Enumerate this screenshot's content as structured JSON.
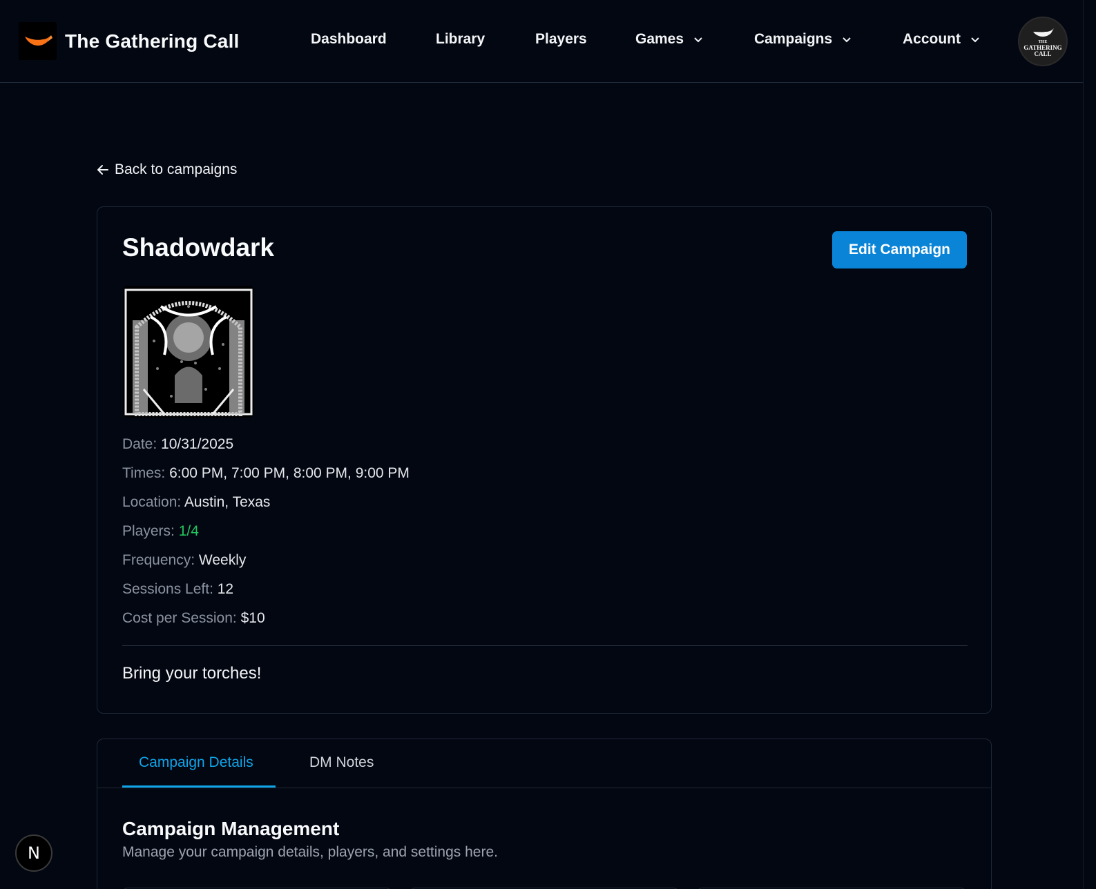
{
  "app": {
    "name": "The Gathering Call",
    "avatar_text_small": "THE",
    "avatar_text_main": "GATHERING",
    "avatar_text_end": "CALL"
  },
  "nav": {
    "dashboard": "Dashboard",
    "library": "Library",
    "players": "Players",
    "games": "Games",
    "campaigns": "Campaigns",
    "account": "Account"
  },
  "back_link": "Back to campaigns",
  "campaign": {
    "title": "Shadowdark",
    "edit_label": "Edit Campaign",
    "details": [
      {
        "label": "Date:",
        "value": "10/31/2025"
      },
      {
        "label": "Times:",
        "value": "6:00 PM, 7:00 PM, 8:00 PM, 9:00 PM"
      },
      {
        "label": "Location:",
        "value": "Austin, Texas"
      },
      {
        "label": "Players:",
        "value": "1/4"
      },
      {
        "label": "Frequency:",
        "value": "Weekly"
      },
      {
        "label": "Sessions Left:",
        "value": "12"
      },
      {
        "label": "Cost per Session:",
        "value": "$10"
      }
    ],
    "description": "Bring your torches!"
  },
  "tabs": [
    {
      "label": "Campaign Details"
    },
    {
      "label": "DM Notes"
    }
  ],
  "management": {
    "title": "Campaign Management",
    "subtitle": "Manage your campaign details, players, and settings here."
  },
  "dev_badge": "N",
  "colors": {
    "background": "#030712",
    "accent": "#0a84d6",
    "tab_active": "#0ea5e9",
    "players_ok": "#22c55e",
    "brand_orange": "#f97316"
  },
  "icons": {
    "brand": "horn-icon",
    "back": "arrow-left-icon",
    "dropdown": "chevron-down-icon"
  }
}
